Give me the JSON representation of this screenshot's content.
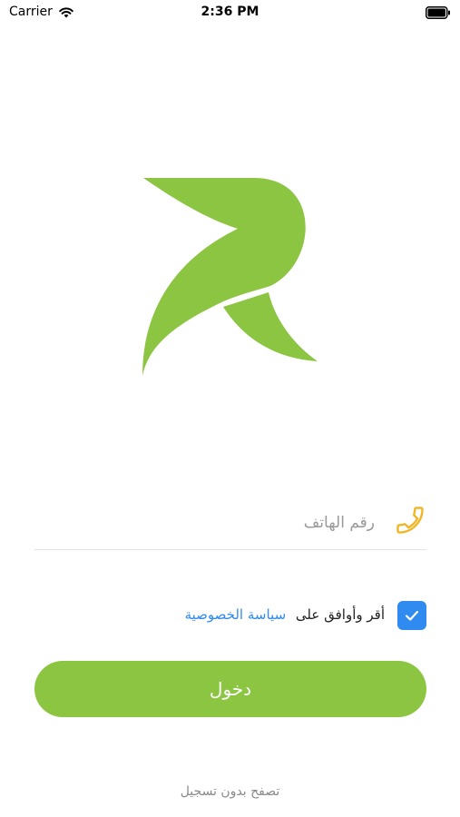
{
  "status_bar": {
    "carrier": "Carrier",
    "time": "2:36 PM"
  },
  "brand": {
    "accent_color": "#8bc541",
    "link_color": "#2f8bf0"
  },
  "login": {
    "phone_placeholder": "رقم الهاتف",
    "phone_value": "",
    "terms_prefix": "أقر وأوافق على",
    "terms_link": "سياسة الخصوصية",
    "terms_checked": true,
    "login_button": "دخول",
    "guest_link": "تصفح بدون تسجيل"
  },
  "icons": {
    "phone": "phone-icon",
    "checkbox": "checkmark-icon",
    "wifi": "wifi-icon",
    "battery": "battery-icon",
    "logo": "brand-logo"
  }
}
